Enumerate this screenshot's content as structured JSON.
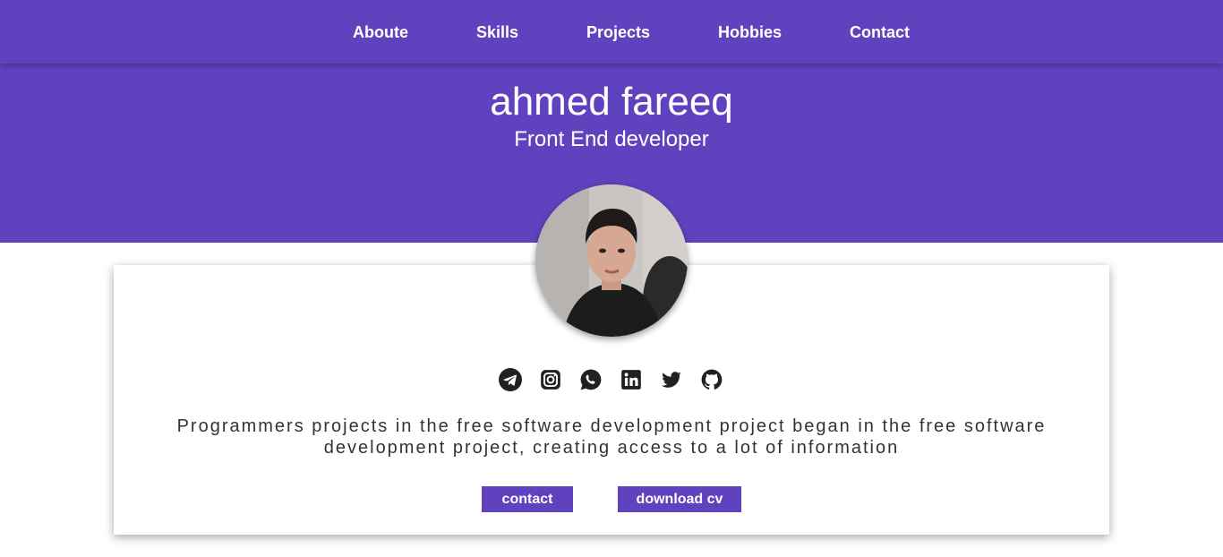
{
  "nav": {
    "items": [
      {
        "label": "Aboute"
      },
      {
        "label": "Skills"
      },
      {
        "label": "Projects"
      },
      {
        "label": "Hobbies"
      },
      {
        "label": "Contact"
      }
    ]
  },
  "hero": {
    "name": "ahmed fareeq",
    "role": "Front End developer"
  },
  "profile": {
    "social": [
      "telegram-icon",
      "instagram-icon",
      "whatsapp-icon",
      "linkedin-icon",
      "twitter-icon",
      "github-icon"
    ],
    "bio": "Programmers projects in the free software development project began in the free software development project, creating access to a lot of information",
    "buttons": {
      "contact": "contact",
      "download": "download cv"
    }
  },
  "colors": {
    "accent": "#6142be",
    "icon": "#212121",
    "text": "#333333"
  }
}
